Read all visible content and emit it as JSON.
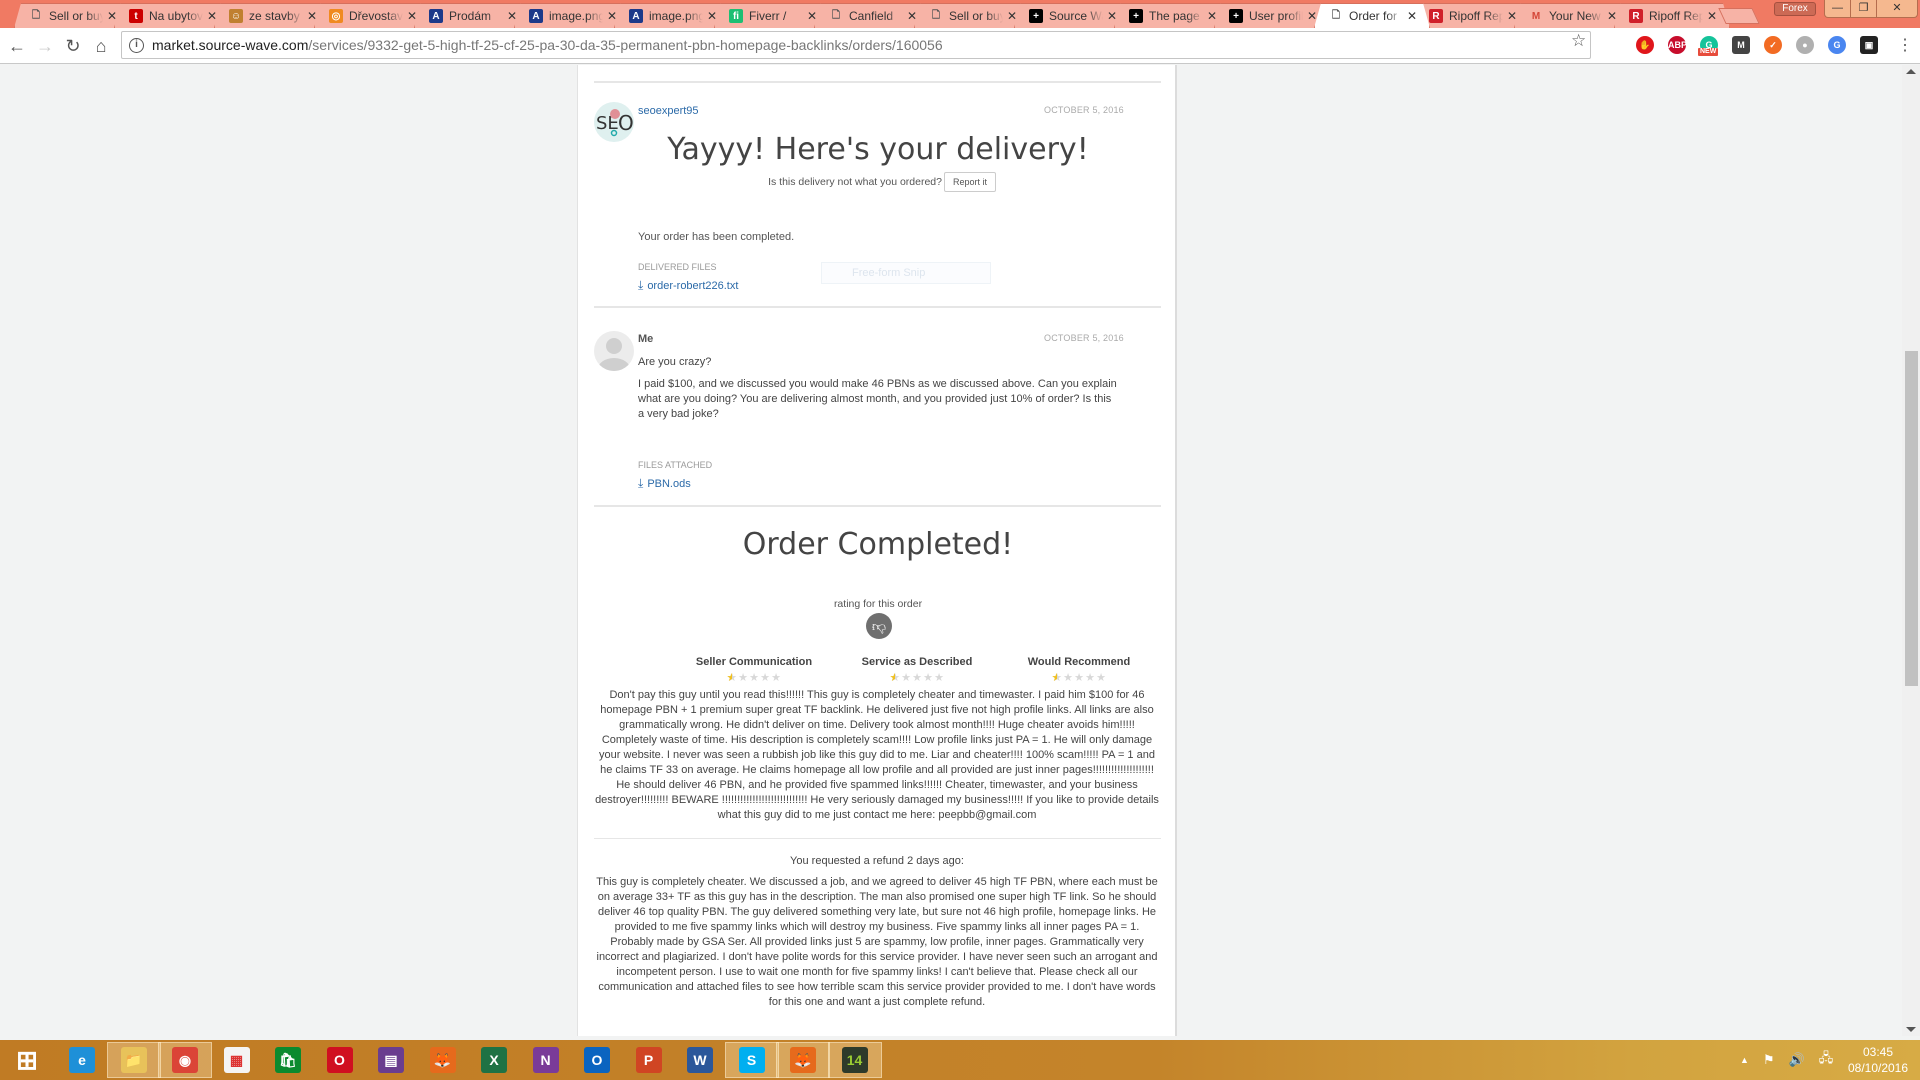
{
  "browser": {
    "tabs": [
      {
        "label": "Sell or buy",
        "icon": "document-icon",
        "color": "#ffffff"
      },
      {
        "label": "Na ubytování",
        "icon": "t-logo-icon",
        "color": "#cc0000"
      },
      {
        "label": "ze stavby",
        "icon": "cartoon-icon",
        "color": "#c08030"
      },
      {
        "label": "Dřevostavby",
        "icon": "circle-logo-icon",
        "color": "#f08a20"
      },
      {
        "label": "Prodám",
        "icon": "app-icon",
        "color": "#1d3a8a"
      },
      {
        "label": "image.png",
        "icon": "app-icon",
        "color": "#1d3a8a"
      },
      {
        "label": "image.png",
        "icon": "app-icon",
        "color": "#1d3a8a"
      },
      {
        "label": "Fiverr /",
        "icon": "fiverr-icon",
        "color": "#1dbf73"
      },
      {
        "label": "Canfield",
        "icon": "document-icon",
        "color": "#ffffff"
      },
      {
        "label": "Sell or buy",
        "icon": "document-icon",
        "color": "#ffffff"
      },
      {
        "label": "Source Wave",
        "icon": "plus-icon",
        "color": "#000000"
      },
      {
        "label": "The page",
        "icon": "plus-icon",
        "color": "#000000"
      },
      {
        "label": "User profile",
        "icon": "plus-icon",
        "color": "#000000"
      },
      {
        "label": "Order for",
        "icon": "document-icon",
        "color": "#ffffff",
        "active": true
      },
      {
        "label": "Ripoff Report",
        "icon": "ripoff-icon",
        "color": "#d0202a"
      },
      {
        "label": "Your New",
        "icon": "gmail-icon",
        "color": "#ffffff"
      },
      {
        "label": "Ripoff Report",
        "icon": "ripoff-icon",
        "color": "#d0202a"
      }
    ],
    "profile_name": "Forex",
    "window_controls": {
      "minimize": "—",
      "restore": "❐",
      "close": "✕"
    },
    "url_host": "market.source-wave.com",
    "url_path": "/services/9332-get-5-high-tf-25-cf-25-pa-30-da-35-permanent-pbn-homepage-backlinks/orders/160056",
    "extensions": [
      {
        "name": "opera-vpn-icon",
        "glyph": "✋",
        "color": "#e0161b"
      },
      {
        "name": "adblock-plus-icon",
        "glyph": "ABP",
        "color": "#c70d2c"
      },
      {
        "name": "grammarly-icon",
        "glyph": "G",
        "color": "#15c39a",
        "badge": "NEW"
      },
      {
        "name": "m-extension-icon",
        "glyph": "M",
        "color": "#444444"
      },
      {
        "name": "orange-broom-icon",
        "glyph": "✓",
        "color": "#f26b23"
      },
      {
        "name": "chat-bubbles-icon",
        "glyph": "●",
        "color": "#b0b0b0"
      },
      {
        "name": "google-translate-icon",
        "glyph": "G",
        "color": "#4a86f0"
      },
      {
        "name": "dark-extension-icon",
        "glyph": "▣",
        "color": "#222222"
      }
    ]
  },
  "delivery": {
    "username": "seoexpert95",
    "date": "OCTOBER 5, 2016",
    "title": "Yayyy! Here's your delivery!",
    "report_prompt": "Is this delivery not what you ordered?",
    "report_button": "Report it",
    "message": "Your order has been completed.",
    "files_label": "DELIVERED FILES",
    "file_name": "order-robert226.txt",
    "snip_overlay": "Free-form Snip"
  },
  "reply": {
    "username": "Me",
    "date": "OCTOBER 5, 2016",
    "line1": "Are you crazy?",
    "paragraph": "I paid $100, and we discussed you would make 46 PBNs as we discussed above. Can you explain what are you doing? You are delivering almost month, and you provided just 10% of order? Is this a very bad joke?",
    "files_label": "FILES ATTACHED",
    "file_name": "PBN.ods"
  },
  "completion": {
    "title": "Order Completed!",
    "rating_label": "rating for this order",
    "rating_icon": "thumbs-down-icon",
    "ratings": [
      {
        "label": "Seller Communication",
        "stars": 0.5,
        "max": 5
      },
      {
        "label": "Service as Described",
        "stars": 0.5,
        "max": 5
      },
      {
        "label": "Would Recommend",
        "stars": 0.5,
        "max": 5
      }
    ],
    "review": "Don't pay this guy until you read this!!!!!! This guy is completely cheater and timewaster. I paid him $100 for 46 homepage PBN + 1 premium super great TF backlink. He delivered just five not high profile links. All links are also grammatically wrong. He didn't deliver on time. Delivery took almost month!!!! Huge cheater avoids him!!!!! Completely waste of time. His description is completely scam!!!! Low profile links just PA = 1. He will only damage your website. I never was seen a rubbish job like this guy did to me. Liar and cheater!!!! 100% scam!!!!! PA = 1 and he claims TF 33 on average. He claims homepage all low profile and all provided are just inner pages!!!!!!!!!!!!!!!!!!!! He should deliver 46 PBN, and he provided five spammed links!!!!!! Cheater, timewaster, and your business destroyer!!!!!!!!! BEWARE !!!!!!!!!!!!!!!!!!!!!!!!!!!! He very seriously damaged my business!!!!! If you like to provide details what this guy did to me just contact me here: peepbb@gmail.com"
  },
  "refund": {
    "heading": "You requested a refund 2 days ago:",
    "text": "This guy is completely cheater. We discussed a job, and we agreed to deliver 45 high TF PBN, where each must be on average 33+ TF as this guy has in the description. The man also promised one super high TF link. So he should deliver 46 top quality PBN. The guy delivered something very late, but sure not 46 high profile, homepage links. He provided to me five spammy links which will destroy my business. Five spammy links all inner pages PA = 1. Probably made by GSA Ser. All provided links just 5 are spammy, low profile, inner pages. Grammatically very incorrect and plagiarized. I don't have polite words for this service provider. I have never seen such an arrogant and incompetent person. I use to wait one month for five spammy links! I can't believe that. Please check all our communication and attached files to see how terrible scam this service provider provided to me. I don't have words for this one and want a just complete refund."
  },
  "scrollbar": {
    "position_fraction": 0.28
  },
  "taskbar": {
    "apps": [
      {
        "name": "start-button",
        "glyph": "⊞",
        "color": "transparent",
        "open": false
      },
      {
        "name": "internet-explorer",
        "glyph": "e",
        "color": "#1e90d8",
        "open": false
      },
      {
        "name": "file-explorer",
        "glyph": "📁",
        "color": "#e8c25a",
        "open": true
      },
      {
        "name": "chrome",
        "glyph": "◉",
        "color": "#db4437",
        "open": true
      },
      {
        "name": "apps-grid",
        "glyph": "▦",
        "color": "#f4f4f4",
        "open": false
      },
      {
        "name": "windows-store",
        "glyph": "🛍",
        "color": "#0b8a2e",
        "open": false
      },
      {
        "name": "opera",
        "glyph": "O",
        "color": "#d01020",
        "open": false
      },
      {
        "name": "winrar",
        "glyph": "▤",
        "color": "#6a3d8f",
        "open": false
      },
      {
        "name": "firefox",
        "glyph": "🦊",
        "color": "#e66a1c",
        "open": false
      },
      {
        "name": "excel",
        "glyph": "X",
        "color": "#1f7244",
        "open": false
      },
      {
        "name": "onenote",
        "glyph": "N",
        "color": "#7a3b98",
        "open": false
      },
      {
        "name": "outlook",
        "glyph": "O",
        "color": "#0a64c0",
        "open": false
      },
      {
        "name": "powerpoint",
        "glyph": "P",
        "color": "#d04523",
        "open": false
      },
      {
        "name": "word",
        "glyph": "W",
        "color": "#2b579a",
        "open": false
      },
      {
        "name": "skype",
        "glyph": "S",
        "color": "#00aff0",
        "open": true
      },
      {
        "name": "firefox-2",
        "glyph": "🦊",
        "color": "#e66a1c",
        "open": true
      },
      {
        "name": "app-14",
        "glyph": "14",
        "color": "#2d3a2a",
        "open": true
      }
    ],
    "tray": {
      "up_arrow": "▲",
      "flag": "⚑",
      "volume": "🔊",
      "network": "🖧"
    },
    "time": "03:45",
    "date": "08/10/2016"
  }
}
